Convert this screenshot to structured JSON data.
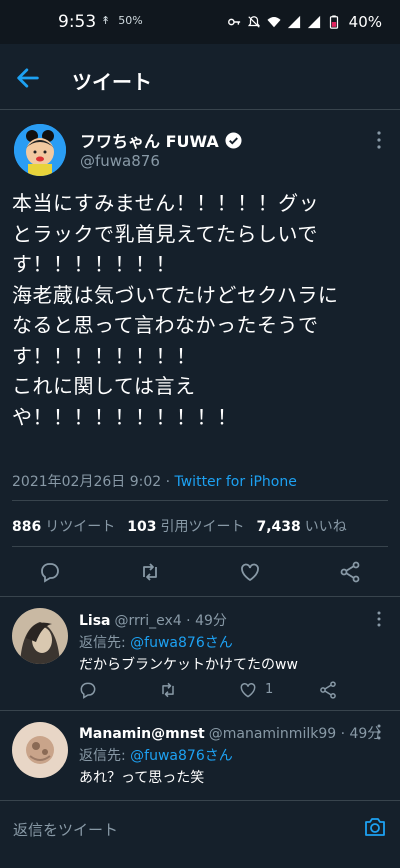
{
  "status_bar": {
    "time": "9:53",
    "left_icon_1": "↟",
    "left_icon_2": "50%",
    "battery": "40%"
  },
  "header": {
    "title": "ツイート"
  },
  "tweet": {
    "author_name": "フワちゃん FUWA",
    "author_handle": "@fuwa876",
    "text": "本当にすみません！！！！！グッ\nとラックで乳首見えてたらしいで\nす！！！！！！！\n海老蔵は気づいてたけどセクハラに\nなると思って言わなかったそうで\nす！！！！！！！！\nこれに関しては言え\nや！！！！！！！！！！",
    "timestamp": "2021年02月26日 9:02 · ",
    "source": "Twitter for iPhone",
    "retweets": "886",
    "retweets_label": "リツイート",
    "quotes": "103",
    "quotes_label": "引用ツイート",
    "likes": "7,438",
    "likes_label": "いいね"
  },
  "replies": [
    {
      "name": "Lisa",
      "handle_time": "@rrri_ex4 · 49分",
      "reply_to_label": "返信先: ",
      "reply_to_handle": "@fuwa876さん",
      "text": "だからブランケットかけてたのww",
      "like_count": "1"
    },
    {
      "name": "Manamin@mnst",
      "handle_time": "@manaminmilk99 · 49分",
      "reply_to_label": "返信先: ",
      "reply_to_handle": "@fuwa876さん",
      "text": "あれ？って思った笑",
      "like_count": ""
    }
  ],
  "compose": {
    "placeholder": "返信をツイート"
  },
  "colors": {
    "background": "#15202b",
    "accent": "#1da1f2",
    "muted": "#8899a6",
    "border": "#38444d"
  }
}
